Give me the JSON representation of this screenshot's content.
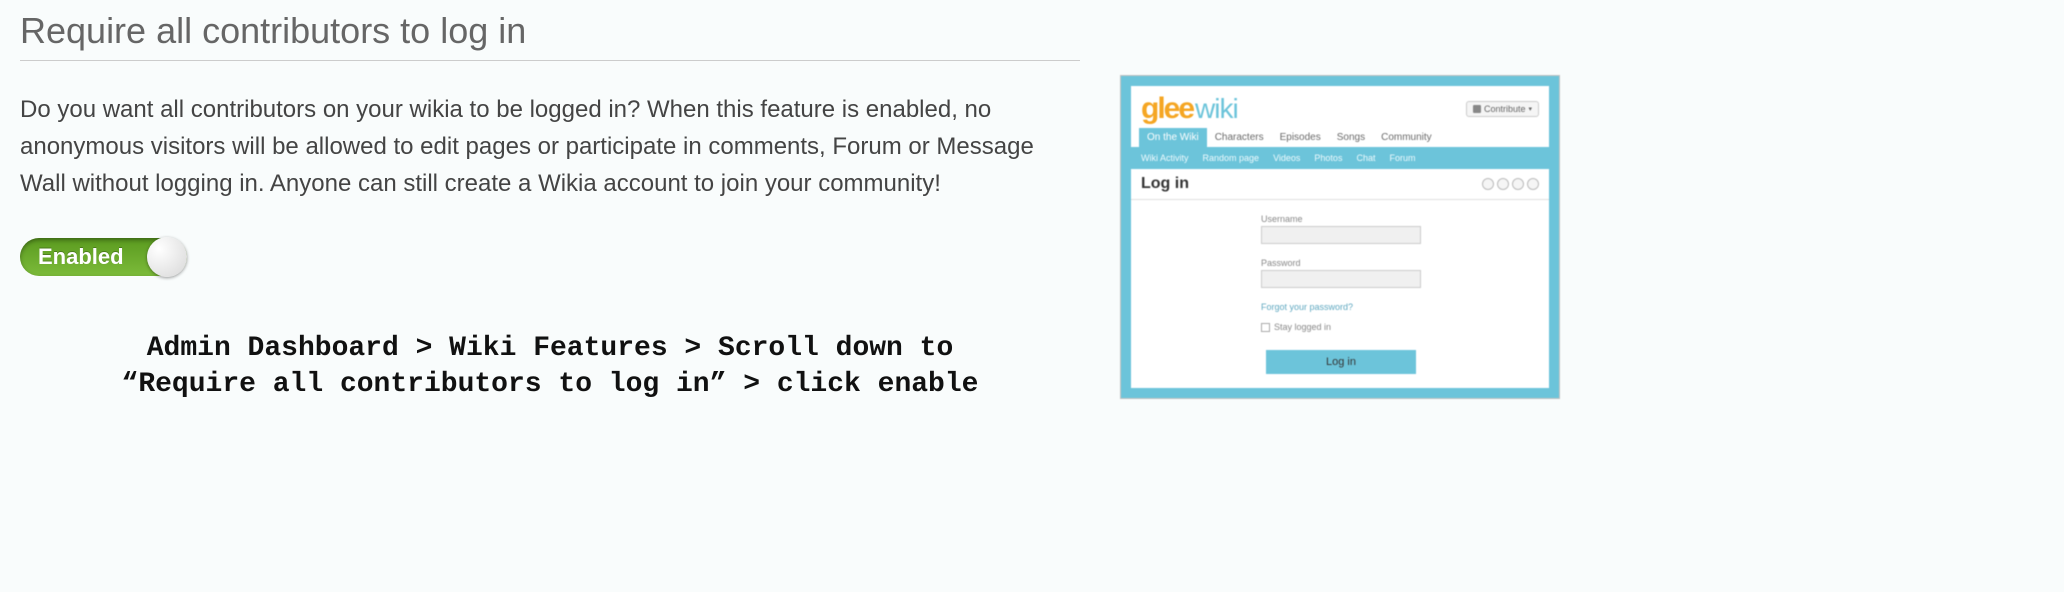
{
  "section": {
    "title": "Require all contributors to log in",
    "description": "Do you want all contributors on your wikia to be logged in? When this feature is enabled, no anonymous visitors will be allowed to edit pages or participate in comments, Forum or Message Wall without logging in. Anyone can still create a Wikia account to join your community!"
  },
  "toggle": {
    "label": "Enabled"
  },
  "instructions": {
    "line1": "Admin Dashboard > Wiki Features > Scroll down to",
    "line2": "“Require all contributors to log in” > click enable"
  },
  "preview": {
    "logo_bold": "glee",
    "logo_light": "wiki",
    "contribute": "Contribute",
    "tabs": [
      "On the Wiki",
      "Characters",
      "Episodes",
      "Songs",
      "Community"
    ],
    "subtabs": [
      "Wiki Activity",
      "Random page",
      "Videos",
      "Photos",
      "Chat",
      "Forum"
    ],
    "login_title": "Log in",
    "username_label": "Username",
    "password_label": "Password",
    "forgot": "Forgot your password?",
    "stay": "Stay logged in",
    "login_button": "Log in"
  }
}
